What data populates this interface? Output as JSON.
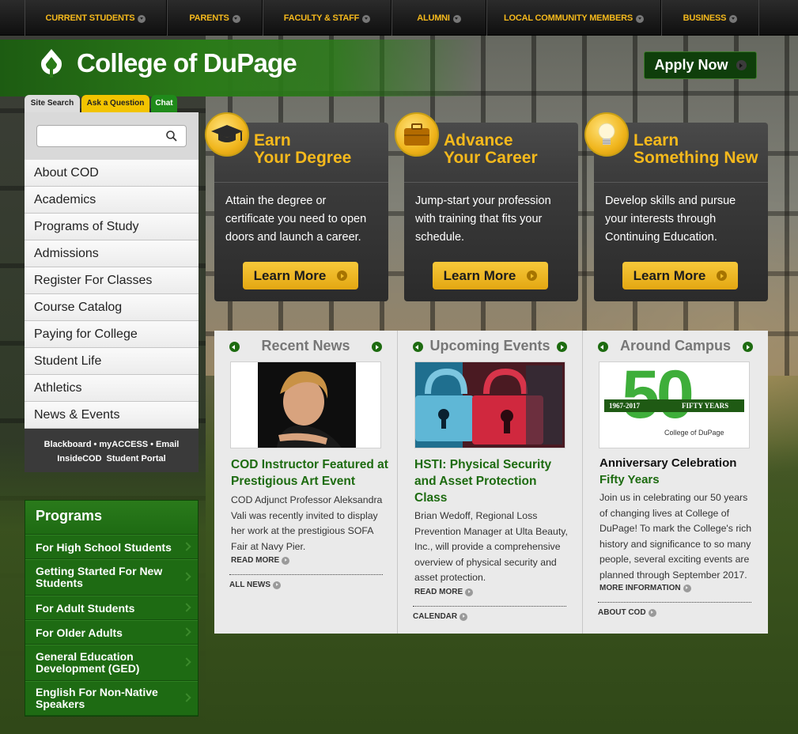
{
  "topnav": {
    "items": [
      {
        "label": "CURRENT STUDENTS"
      },
      {
        "label": "PARENTS"
      },
      {
        "label": "FACULTY & STAFF"
      },
      {
        "label": "ALUMNI"
      },
      {
        "label": "LOCAL COMMUNITY MEMBERS"
      },
      {
        "label": "BUSINESS"
      }
    ]
  },
  "header": {
    "logo_text": "College of DuPage",
    "apply_label": "Apply Now"
  },
  "search": {
    "tabs": [
      "Site Search",
      "Ask a Question",
      "Chat"
    ],
    "placeholder": ""
  },
  "leftnav": {
    "items": [
      "About COD",
      "Academics",
      "Programs of Study",
      "Admissions",
      "Register For Classes",
      "Course Catalog",
      "Paying for College",
      "Student Life",
      "Athletics",
      "News & Events"
    ]
  },
  "quicklinks": [
    "Blackboard",
    "myACCESS",
    "Email",
    "InsideCOD",
    "Student Portal"
  ],
  "programs": {
    "title": "Programs",
    "items": [
      "For High School Students",
      "Getting Started For New Students",
      "For Adult Students",
      "For Older Adults",
      "General Education Development (GED)",
      "English For Non-Native Speakers"
    ]
  },
  "cards": [
    {
      "title1": "Earn",
      "title2": "Your Degree",
      "desc": "Attain the degree or certificate you need to open doors and launch a career.",
      "button": "Learn More",
      "icon": "graduation-cap-icon"
    },
    {
      "title1": "Advance",
      "title2": "Your Career",
      "desc": "Jump-start your profession with training that fits your schedule.",
      "button": "Learn More",
      "icon": "briefcase-icon"
    },
    {
      "title1": "Learn",
      "title2": "Something New",
      "desc": "Develop skills and pursue your interests through Continuing Education.",
      "button": "Learn More",
      "icon": "lightbulb-icon"
    }
  ],
  "news": {
    "recent": {
      "heading": "Recent News",
      "title": "COD Instructor Featured at Prestigious Art Event",
      "body": "COD Adjunct Professor Aleksandra Vali was recently invited to display her work at the prestigious SOFA Fair at Navy Pier.",
      "more": "READ MORE",
      "all": "ALL NEWS"
    },
    "events": {
      "heading": "Upcoming Events",
      "title": "HSTI: Physical Security and Asset Protection Class",
      "body": "Brian Wedoff, Regional Loss Prevention Manager at Ulta Beauty, Inc., will provide a comprehensive overview of physical security and asset protection.",
      "more": "READ MORE",
      "all": "CALENDAR"
    },
    "campus": {
      "heading": "Around Campus",
      "title": "Anniversary Celebration",
      "subtitle": "Fifty Years",
      "body": "Join us in celebrating our 50 years of changing lives at College of DuPage! To mark the College's rich history and significance to so many people, several exciting events are planned through September 2017.",
      "more": "MORE INFORMATION",
      "all": "ABOUT COD",
      "logo_years": "1967-2017",
      "logo_fifty": "FIFTY YEARS",
      "logo_number": "50",
      "logo_college": "College of DuPage"
    }
  },
  "colors": {
    "brand_green": "#1e6b13",
    "gold": "#f5b91c",
    "dark": "#2b2b2b"
  }
}
